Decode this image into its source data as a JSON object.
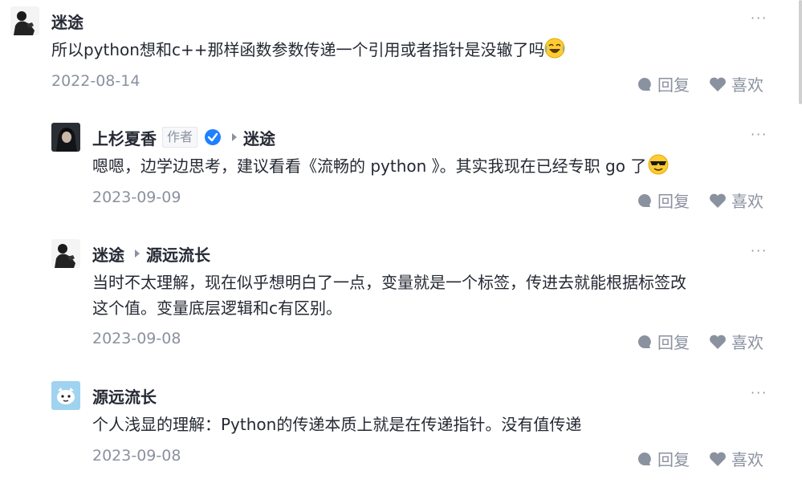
{
  "comments": [
    {
      "user": "迷途",
      "text": "所以python想和c++那样函数参数传递一个引用或者指针是没辙了吗",
      "emoji": "crying-laughing-emoji",
      "date": "2022-08-14",
      "reply_label": "回复",
      "like_label": "喜欢",
      "more": "···"
    },
    {
      "user": "上杉夏香",
      "author_tag": "作者",
      "verified": true,
      "reply_to": "迷途",
      "text": "嗯嗯，边学边思考，建议看看《流畅的 python 》。其实我现在已经专职 go 了",
      "emoji": "cool-sunglasses-emoji",
      "date": "2023-09-09",
      "reply_label": "回复",
      "like_label": "喜欢",
      "more": "···"
    },
    {
      "user": "迷途",
      "reply_to": "源远流长",
      "text_line1": "当时不太理解，现在似乎想明白了一点，变量就是一个标签，传进去就能根据标签改",
      "text_line2": "这个值。变量底层逻辑和c有区别。",
      "date": "2023-09-08",
      "reply_label": "回复",
      "like_label": "喜欢",
      "more": "···"
    },
    {
      "user": "源远流长",
      "text": "个人浅显的理解：Python的传递本质上就是在传递指针。没有值传递",
      "date": "2023-09-08",
      "reply_label": "回复",
      "like_label": "喜欢",
      "more": "···"
    }
  ],
  "colors": {
    "text": "#252933",
    "muted": "#8a919f",
    "verified_blue": "#1e80ff"
  }
}
